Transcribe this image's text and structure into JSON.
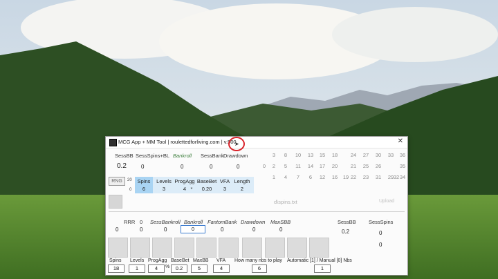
{
  "window": {
    "title": "MCG App + MM Tool | roulettedforliving.com | v.500",
    "close_glyph": "✕"
  },
  "top_stats": {
    "headers": [
      "SessBB",
      "SessSpins+BL",
      "Bankroll",
      "SessBank",
      "Drawdown"
    ],
    "values": [
      "0.2",
      "0",
      "0",
      "0",
      "0"
    ]
  },
  "grid_numbers": {
    "row1": [
      "3",
      "8",
      "10",
      "13",
      "15",
      "18",
      "24",
      "27",
      "30",
      "33",
      "36"
    ],
    "row2": [
      "0",
      "2",
      "5",
      "11",
      "14",
      "17",
      "20",
      "21",
      "25",
      "26",
      "35"
    ],
    "row3": [
      "1",
      "4",
      "7",
      "6",
      "12",
      "16",
      "19",
      "22",
      "23",
      "31",
      "29",
      "32",
      "34"
    ]
  },
  "rng": {
    "label": "RNG",
    "count_a": "20",
    "count_b": "0"
  },
  "prog_table": {
    "headers": [
      "Spins",
      "Levels",
      "ProgAgg",
      "BaseBet",
      "VFA",
      "Length"
    ],
    "values": [
      "6",
      "3",
      "4",
      "0.20",
      "3",
      "2"
    ],
    "marker": "*"
  },
  "file": {
    "name": "d\\spins.txt",
    "upload_label": "Upload"
  },
  "middle": {
    "headers": [
      "RRR",
      "0",
      "SessBankroll",
      "Bankroll",
      "FantomBank",
      "Drawdown",
      "MaxSBB"
    ],
    "values": [
      "0",
      "0",
      "0",
      "0",
      "0",
      "0",
      "0"
    ],
    "right_headers": [
      "SessBB",
      "SessSpins"
    ],
    "right_values": [
      "0.2",
      "0",
      "0"
    ]
  },
  "settings": {
    "labels": [
      "Spins",
      "Levels",
      "ProgAgg",
      "BaseBet",
      "MaxBB",
      "VFA",
      "How many nbs to play",
      "Automatic [1] / Manual [0] Nbs"
    ],
    "values": [
      "18",
      "1",
      "4",
      "0.2",
      "5",
      "4",
      "6",
      "1"
    ],
    "percent": "%"
  }
}
